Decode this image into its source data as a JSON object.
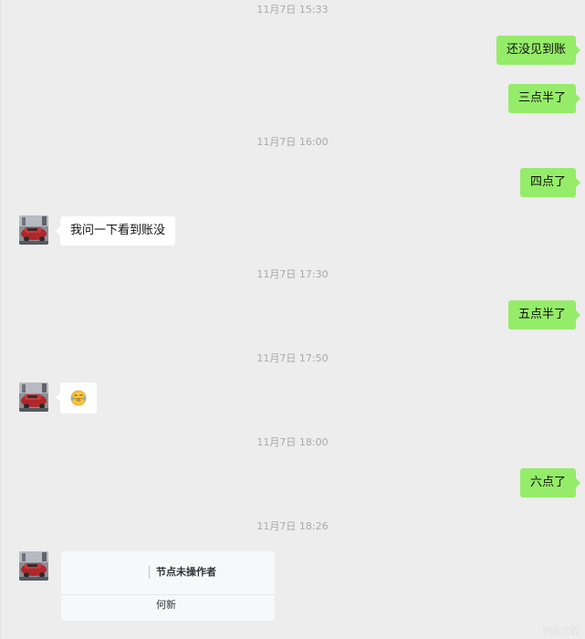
{
  "chat": {
    "timestamps": [
      "11月7日 15:33",
      "11月7日 16:00",
      "11月7日 17:30",
      "11月7日 17:50",
      "11月7日 18:00",
      "11月7日 18:26"
    ],
    "messages": [
      {
        "direction": "sent",
        "text": "还没见到账"
      },
      {
        "direction": "sent",
        "text": "三点半了"
      },
      {
        "direction": "sent",
        "text": "四点了"
      },
      {
        "direction": "received",
        "text": "我问一下看到账没"
      },
      {
        "direction": "sent",
        "text": "五点半了"
      },
      {
        "direction": "received",
        "type": "emoji",
        "emoji": "laughing-tears-emoji"
      },
      {
        "direction": "sent",
        "text": "六点了"
      },
      {
        "direction": "received",
        "type": "card"
      }
    ],
    "card": {
      "title": "节点未操作者",
      "body": "何新"
    }
  },
  "colors": {
    "background": "#ededed",
    "sent_bubble": "#95ec69",
    "received_bubble": "#ffffff",
    "timestamp_text": "#a8a8a8"
  },
  "watermark": "汽车之家"
}
